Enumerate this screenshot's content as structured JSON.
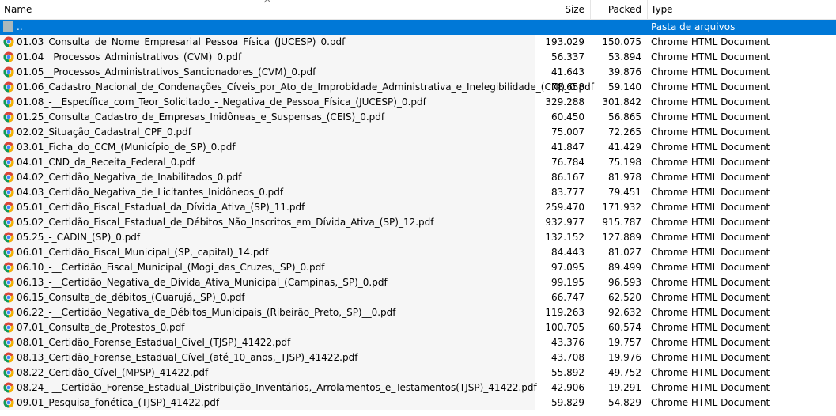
{
  "columns": {
    "name": "Name",
    "size": "Size",
    "packed": "Packed",
    "type": "Type"
  },
  "parent_row": {
    "name": "..",
    "type": "Pasta de arquivos"
  },
  "rows": [
    {
      "name": "01.03_Consulta_de_Nome_Empresarial_Pessoa_Física_(JUCESP)_0.pdf",
      "size": "193.029",
      "packed": "150.075",
      "type": "Chrome HTML Document"
    },
    {
      "name": "01.04__Processos_Administrativos_(CVM)_0.pdf",
      "size": "56.337",
      "packed": "53.894",
      "type": "Chrome HTML Document"
    },
    {
      "name": "01.05__Processos_Administrativos_Sancionadores_(CVM)_0.pdf",
      "size": "41.643",
      "packed": "39.876",
      "type": "Chrome HTML Document"
    },
    {
      "name": "01.06_Cadastro_Nacional_de_Condenações_Cíveis_por_Ato_de_Improbidade_Administrativa_e_Inelegibilidade_(CNJ)_0.pdf",
      "size": "78.658",
      "packed": "59.140",
      "type": "Chrome HTML Document"
    },
    {
      "name": "01.08_-__Específica_com_Teor_Solicitado_-_Negativa_de_Pessoa_Física_(JUCESP)_0.pdf",
      "size": "329.288",
      "packed": "301.842",
      "type": "Chrome HTML Document"
    },
    {
      "name": "01.25_Consulta_Cadastro_de_Empresas_Inidôneas_e_Suspensas_(CEIS)_0.pdf",
      "size": "60.450",
      "packed": "56.865",
      "type": "Chrome HTML Document"
    },
    {
      "name": "02.02_Situação_Cadastral_CPF_0.pdf",
      "size": "75.007",
      "packed": "72.265",
      "type": "Chrome HTML Document"
    },
    {
      "name": "03.01_Ficha_do_CCM_(Município_de_SP)_0.pdf",
      "size": "41.847",
      "packed": "41.429",
      "type": "Chrome HTML Document"
    },
    {
      "name": "04.01_CND_da_Receita_Federal_0.pdf",
      "size": "76.784",
      "packed": "75.198",
      "type": "Chrome HTML Document"
    },
    {
      "name": "04.02_Certidão_Negativa_de_Inabilitados_0.pdf",
      "size": "86.167",
      "packed": "81.978",
      "type": "Chrome HTML Document"
    },
    {
      "name": "04.03_Certidão_Negativa_de_Licitantes_Inidôneos_0.pdf",
      "size": "83.777",
      "packed": "79.451",
      "type": "Chrome HTML Document"
    },
    {
      "name": "05.01_Certidão_Fiscal_Estadual_da_Dívida_Ativa_(SP)_11.pdf",
      "size": "259.470",
      "packed": "171.932",
      "type": "Chrome HTML Document"
    },
    {
      "name": "05.02_Certidão_Fiscal_Estadual_de_Débitos_Não_Inscritos_em_Dívida_Ativa_(SP)_12.pdf",
      "size": "932.977",
      "packed": "915.787",
      "type": "Chrome HTML Document"
    },
    {
      "name": "05.25_-_CADIN_(SP)_0.pdf",
      "size": "132.152",
      "packed": "127.889",
      "type": "Chrome HTML Document"
    },
    {
      "name": "06.01_Certidão_Fiscal_Municipal_(SP,_capital)_14.pdf",
      "size": "84.443",
      "packed": "81.027",
      "type": "Chrome HTML Document"
    },
    {
      "name": "06.10_-__Certidão_Fiscal_Municipal_(Mogi_das_Cruzes,_SP)_0.pdf",
      "size": "97.095",
      "packed": "89.499",
      "type": "Chrome HTML Document"
    },
    {
      "name": "06.13_-__Certidão_Negativa_de_Dívida_Ativa_Municipal_(Campinas,_SP)_0.pdf",
      "size": "99.195",
      "packed": "96.593",
      "type": "Chrome HTML Document"
    },
    {
      "name": "06.15_Consulta_de_débitos_(Guarujá,_SP)_0.pdf",
      "size": "66.747",
      "packed": "62.520",
      "type": "Chrome HTML Document"
    },
    {
      "name": "06.22_-__Certidão_Negativa_de_Débitos_Municipais_(Ribeirão_Preto,_SP)__0.pdf",
      "size": "119.263",
      "packed": "92.632",
      "type": "Chrome HTML Document"
    },
    {
      "name": "07.01_Consulta_de_Protestos_0.pdf",
      "size": "100.705",
      "packed": "60.574",
      "type": "Chrome HTML Document"
    },
    {
      "name": "08.01_Certidão_Forense_Estadual_Cível_(TJSP)_41422.pdf",
      "size": "43.376",
      "packed": "19.757",
      "type": "Chrome HTML Document"
    },
    {
      "name": "08.13_Certidão_Forense_Estadual_Cível_(até_10_anos,_TJSP)_41422.pdf",
      "size": "43.708",
      "packed": "19.976",
      "type": "Chrome HTML Document"
    },
    {
      "name": "08.22_Certidão_Cível_(MPSP)_41422.pdf",
      "size": "55.892",
      "packed": "49.752",
      "type": "Chrome HTML Document"
    },
    {
      "name": "08.24_-__Certidão_Forense_Estadual_Distribuição_Inventários,_Arrolamentos_e_Testamentos(TJSP)_41422.pdf",
      "size": "42.906",
      "packed": "19.291",
      "type": "Chrome HTML Document"
    },
    {
      "name": "09.01_Pesquisa_fonética_(TJSP)_41422.pdf",
      "size": "59.829",
      "packed": "54.829",
      "type": "Chrome HTML Document"
    }
  ],
  "colors": {
    "selection": "#0078d7",
    "name_column_shade": "#f6f6f6",
    "header_divider": "#e5e5e5"
  },
  "icons": {
    "file": "chrome-icon",
    "parent": "folder-up-icon",
    "sort": "sort-ascending-icon"
  }
}
